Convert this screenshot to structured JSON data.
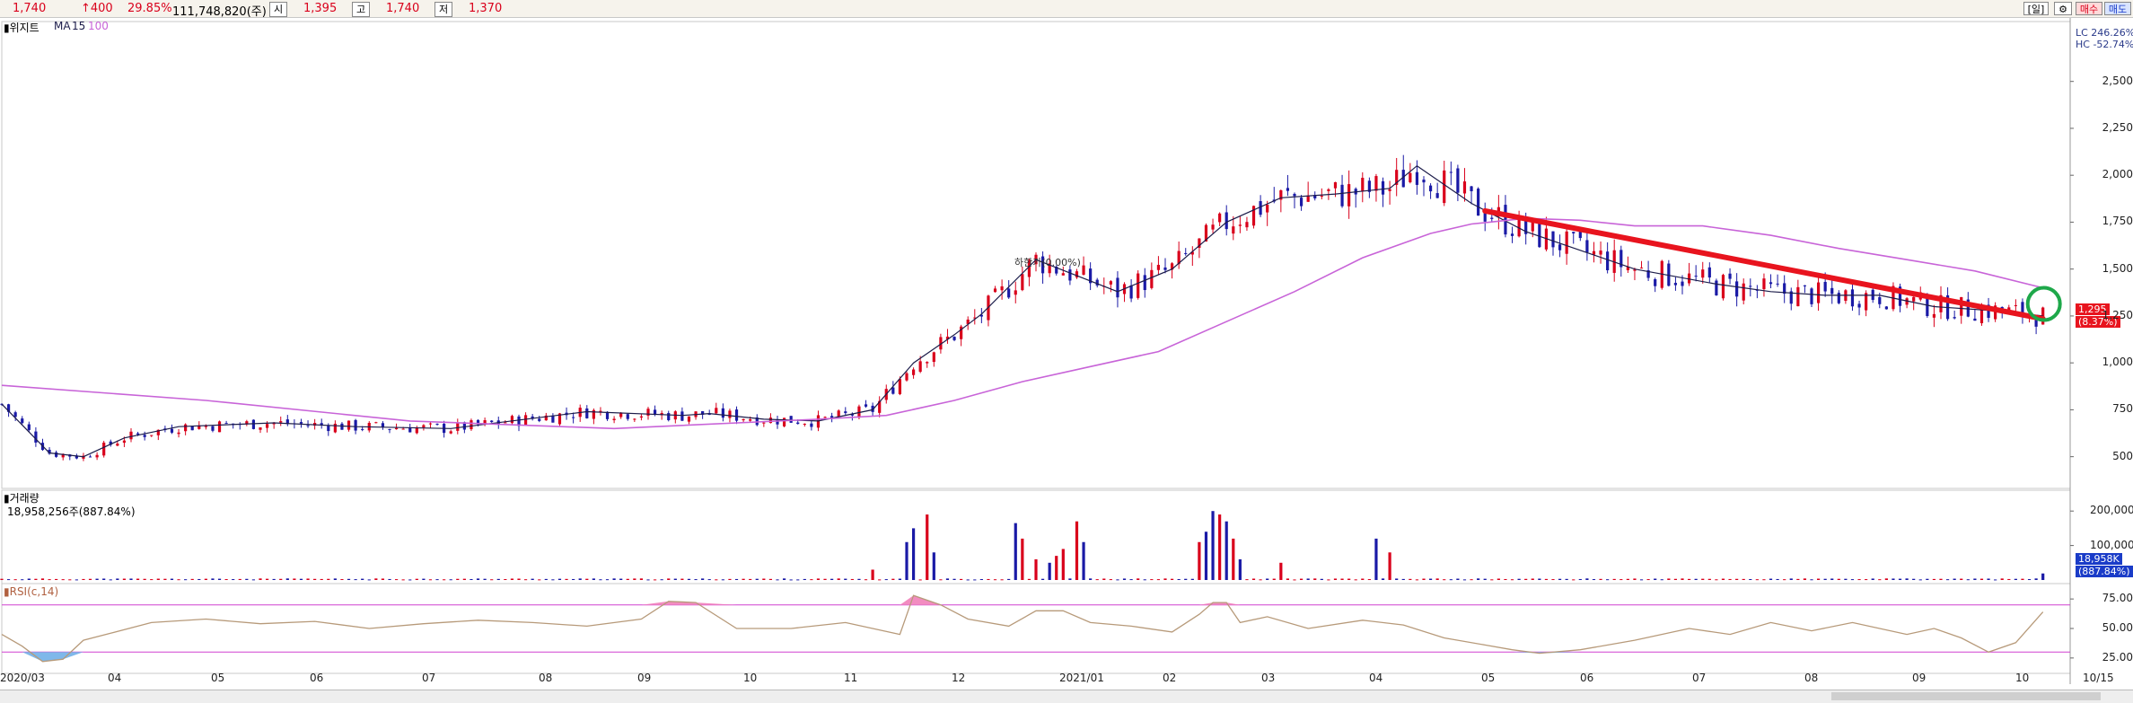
{
  "topbar": {
    "price": "1,740",
    "change": "↑400",
    "change_pct": "29.85%",
    "volume_value": "111,748,820(주)",
    "open_label": "시",
    "open_value": "1,395",
    "high_label": "고",
    "high_value": "1,740",
    "low_label": "저",
    "low_value": "1,370",
    "period_label": "[일]",
    "buy_label": "매수",
    "sell_label": "매도"
  },
  "price_panel": {
    "stock_name": "▮위지트",
    "ma_label": "MA",
    "ma_short": "15",
    "ma_long": "100",
    "lc_label": "LC 246.26%",
    "hc_label": "HC -52.74%",
    "annotation": "하한가(0.00%)",
    "current_value": "1,295",
    "current_pct": "(8.37%)"
  },
  "volume_panel": {
    "label": "▮거래량",
    "value_label": "18,958,256주(887.84%)",
    "current_value": "18,958K",
    "current_pct": "(887.84%)"
  },
  "rsi_panel": {
    "label": "▮RSI(c,14)"
  },
  "colors": {
    "up": "#d9001b",
    "down": "#1a1aa6",
    "ma15": "#1c1c4a",
    "ma100": "#c864d8",
    "trend": "#e8141e",
    "rsi": "#b79a7a",
    "rsi_fill_high": "#f28cc0",
    "rsi_fill_low": "#7fb8ea",
    "circle": "#1ea84a"
  },
  "chart_data": [
    {
      "type": "candlestick",
      "title": "위지트",
      "ylim": [
        350,
        2800
      ],
      "yticks": [
        500,
        750,
        1000,
        1250,
        1500,
        1750,
        2000,
        2250,
        2500
      ],
      "ytick_labels": [
        "500",
        "750",
        "1,000",
        "1,250",
        "1,500",
        "1,750",
        "2,000",
        "2,250",
        "2,500"
      ],
      "xtick_labels": [
        "2020/03",
        "04",
        "05",
        "06",
        "07",
        "08",
        "09",
        "10",
        "11",
        "12",
        "2021/01",
        "02",
        "03",
        "04",
        "05",
        "06",
        "07",
        "08",
        "09",
        "10",
        "10/15"
      ],
      "series": [
        {
          "name": "MA 15",
          "x": [
            0,
            35,
            60,
            90,
            130,
            200,
            260,
            330,
            430,
            500,
            520,
            560,
            600,
            640,
            670,
            700,
            720,
            760,
            820,
            860,
            900,
            940,
            980,
            1020,
            1040,
            1080,
            1120,
            1160,
            1200,
            1260,
            1300,
            1340,
            1380,
            1420,
            1460,
            1500
          ],
          "values": [
            780,
            520,
            500,
            600,
            660,
            680,
            660,
            650,
            740,
            720,
            730,
            700,
            690,
            750,
            1000,
            1150,
            1260,
            1550,
            1380,
            1500,
            1750,
            1880,
            1900,
            1930,
            2050,
            1850,
            1700,
            1600,
            1500,
            1420,
            1380,
            1360,
            1360,
            1300,
            1280,
            1250
          ]
        },
        {
          "name": "MA 100",
          "x": [
            0,
            150,
            300,
            450,
            600,
            650,
            700,
            750,
            800,
            850,
            900,
            950,
            1000,
            1050,
            1080,
            1120,
            1160,
            1200,
            1250,
            1300,
            1350,
            1400,
            1450,
            1500
          ],
          "values": [
            880,
            800,
            690,
            650,
            700,
            720,
            800,
            900,
            980,
            1060,
            1220,
            1380,
            1560,
            1690,
            1740,
            1770,
            1760,
            1730,
            1730,
            1680,
            1610,
            1550,
            1490,
            1400
          ]
        }
      ],
      "trend_line": {
        "x": [
          1090,
          1500
        ],
        "values": [
          1810,
          1235
        ]
      },
      "current_price": 1295
    },
    {
      "type": "bar",
      "title": "거래량",
      "ylim": [
        0,
        250000
      ],
      "yticks": [
        100000,
        200000
      ],
      "ytick_labels": [
        "100,000K",
        "200,000K"
      ],
      "notable_x": [
        640,
        665,
        672,
        680,
        686,
        745,
        752,
        758,
        768,
        775,
        782,
        790,
        795,
        880,
        885,
        890,
        895,
        900,
        905,
        910,
        940,
        1010,
        1020,
        1500
      ],
      "notable_values": [
        30000,
        110000,
        150000,
        190000,
        80000,
        165000,
        120000,
        60000,
        50000,
        70000,
        90000,
        170000,
        110000,
        110000,
        140000,
        200000,
        190000,
        170000,
        120000,
        60000,
        50000,
        120000,
        80000,
        18958
      ]
    },
    {
      "type": "line",
      "title": "RSI(c,14)",
      "ylim": [
        15,
        85
      ],
      "yticks": [
        25,
        50,
        75
      ],
      "ytick_labels": [
        "25.00",
        "50.00",
        "75.00"
      ],
      "reference_lines": [
        70,
        30
      ],
      "x": [
        0,
        15,
        30,
        45,
        60,
        80,
        110,
        150,
        190,
        230,
        270,
        310,
        350,
        390,
        430,
        470,
        490,
        510,
        540,
        580,
        620,
        660,
        670,
        690,
        710,
        740,
        760,
        780,
        800,
        830,
        860,
        880,
        890,
        900,
        910,
        930,
        960,
        1000,
        1030,
        1060,
        1090,
        1110,
        1130,
        1160,
        1200,
        1240,
        1270,
        1300,
        1330,
        1360,
        1400,
        1420,
        1440,
        1460,
        1480,
        1500
      ],
      "values": [
        45,
        35,
        22,
        24,
        40,
        46,
        55,
        58,
        54,
        56,
        50,
        54,
        57,
        55,
        52,
        58,
        73,
        72,
        50,
        50,
        55,
        45,
        78,
        70,
        58,
        52,
        65,
        65,
        55,
        52,
        47,
        62,
        72,
        72,
        55,
        60,
        50,
        57,
        53,
        42,
        36,
        32,
        29,
        32,
        40,
        50,
        45,
        55,
        48,
        55,
        45,
        50,
        42,
        30,
        38,
        64
      ]
    }
  ]
}
